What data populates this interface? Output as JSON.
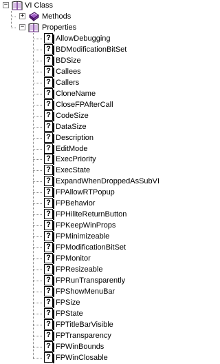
{
  "tree": {
    "root": {
      "label": "VI Class",
      "expander": "−",
      "icon": "open-book-icon"
    },
    "methods": {
      "label": "Methods",
      "expander": "+",
      "icon": "purple-book-icon"
    },
    "properties": {
      "label": "Properties",
      "expander": "−",
      "icon": "open-book-icon"
    },
    "property_icon_glyph": "?",
    "property_items": [
      "AllowDebugging",
      "BDModificationBitSet",
      "BDSize",
      "Callees",
      "Callers",
      "CloneName",
      "CloseFPAfterCall",
      "CodeSize",
      "DataSize",
      "Description",
      "EditMode",
      "ExecPriority",
      "ExecState",
      "ExpandWhenDroppedAsSubVI",
      "FPAllowRTPopup",
      "FPBehavior",
      "FPHiliteReturnButton",
      "FPKeepWinProps",
      "FPMinimizeable",
      "FPModificationBitSet",
      "FPMonitor",
      "FPResizeable",
      "FPRunTransparently",
      "FPShowMenuBar",
      "FPSize",
      "FPState",
      "FPTitleBarVisible",
      "FPTransparency",
      "FPWinBounds",
      "FPWinClosable"
    ]
  }
}
